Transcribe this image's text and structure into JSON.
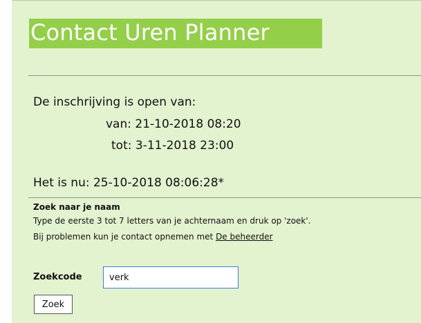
{
  "header": {
    "title": "Contact Uren Planner"
  },
  "registration": {
    "open_label": "De inschrijving is open van:",
    "from": "van: 21-10-2018 08:20",
    "to": "tot: 3-11-2018 23:00",
    "now": "Het is nu: 25-10-2018 08:06:28*"
  },
  "search": {
    "heading": "Zoek naar je naam",
    "instructions": "Type de eerste 3 tot 7 letters van je achternaam en druk op 'zoek'.",
    "problems_prefix": "Bij problemen kun je contact opnemen met ",
    "admin_link": "De beheerder",
    "code_label": "Zoekcode",
    "code_value": "verk",
    "button_label": "Zoek"
  },
  "colors": {
    "page_background": "#e3f2cf",
    "title_background": "#94cf4a",
    "title_text": "#ffffff",
    "input_border": "#3c7fd0"
  }
}
